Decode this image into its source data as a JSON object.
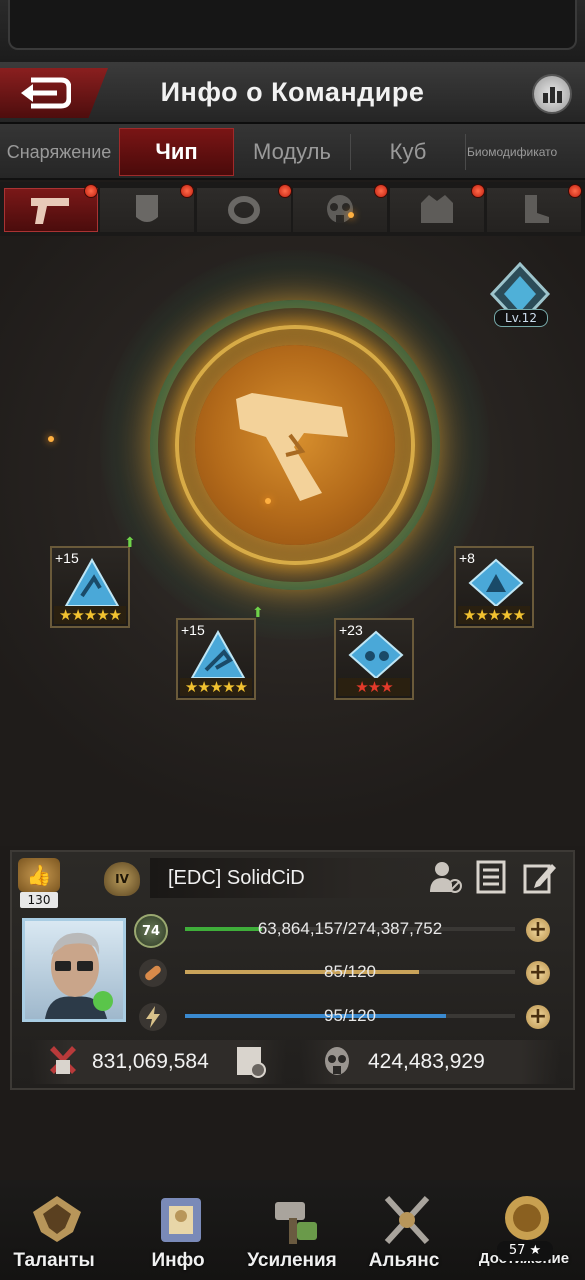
{
  "header": {
    "title": "Инфо о Командире"
  },
  "tabs": [
    {
      "label": "Снаряжение",
      "active": false
    },
    {
      "label": "Чип",
      "active": true
    },
    {
      "label": "Модуль",
      "active": false
    },
    {
      "label": "Куб",
      "active": false
    },
    {
      "label": "Биомодификато",
      "active": false
    }
  ],
  "slots": [
    {
      "icon": "pistol-icon",
      "active": true
    },
    {
      "icon": "armor-plate-icon",
      "active": false
    },
    {
      "icon": "ring-icon",
      "active": false
    },
    {
      "icon": "gas-mask-icon",
      "active": false
    },
    {
      "icon": "jacket-icon",
      "active": false
    },
    {
      "icon": "boot-icon",
      "active": false
    }
  ],
  "chip_core": {
    "icon": "pistol-icon",
    "level": "Lv.12"
  },
  "chips": [
    {
      "plus": "+15",
      "stars": 5,
      "star_color": "#f2c230",
      "upgradable": true
    },
    {
      "plus": "+15",
      "stars": 5,
      "star_color": "#f2c230",
      "upgradable": true
    },
    {
      "plus": "+23",
      "stars": 3,
      "star_color": "#e33a2a",
      "upgradable": false
    },
    {
      "plus": "+8",
      "stars": 5,
      "star_color": "#f2c230",
      "upgradable": false
    }
  ],
  "profile": {
    "likes": "130",
    "rank": "IV",
    "name": "[EDC]  SolidCiD",
    "level": "74",
    "exp_text": "63,864,157/274,387,752",
    "exp_fraction": 0.233,
    "stamina_text": "85/120",
    "stamina_fraction": 0.708,
    "energy_text": "95/120",
    "energy_fraction": 0.792,
    "power": "831,069,584",
    "kills": "424,483,929"
  },
  "nav": [
    {
      "label": "Таланты"
    },
    {
      "label": "Инфо"
    },
    {
      "label": "Усиления"
    },
    {
      "label": "Альянс"
    },
    {
      "label": "Достижение",
      "badge": "57 ★"
    }
  ],
  "colors": {
    "accent_red": "#7a1515",
    "exp_bar": "#3fae3a",
    "stamina_bar": "#c9a35a",
    "energy_bar": "#3a8ad0"
  }
}
